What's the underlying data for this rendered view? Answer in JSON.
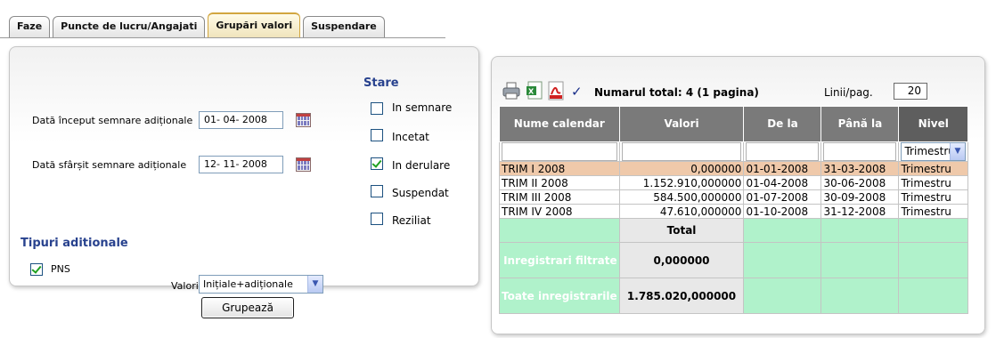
{
  "tabs": [
    {
      "label": "Faze",
      "active": false
    },
    {
      "label": "Puncte de lucru/Angajati",
      "active": false
    },
    {
      "label": "Grupări valori",
      "active": true
    },
    {
      "label": "Suspendare",
      "active": false
    }
  ],
  "form": {
    "start_date": {
      "label": "Dată început semnare adiționale",
      "value": "01- 04- 2008"
    },
    "end_date": {
      "label": "Dată sfârșit semnare adiționale",
      "value": "12- 11- 2008"
    },
    "valori": {
      "label": "Valori",
      "selected": "Inițiale+adiționale"
    }
  },
  "stare": {
    "title": "Stare",
    "options": [
      {
        "label": "In semnare",
        "checked": false
      },
      {
        "label": "Incetat",
        "checked": false
      },
      {
        "label": "In derulare",
        "checked": true
      },
      {
        "label": "Suspendat",
        "checked": false
      },
      {
        "label": "Reziliat",
        "checked": false
      }
    ]
  },
  "tipuri": {
    "title": "Tipuri aditionale",
    "options": [
      {
        "label": "PNS",
        "checked": true
      }
    ]
  },
  "group_button": "Grupează",
  "results": {
    "total_text": "Numarul total: 4 (1 pagina)",
    "lines_label": "Linii/pag.",
    "lines_value": "20",
    "columns": [
      "Nume calendar",
      "Valori",
      "De la",
      "Până la",
      "Nivel"
    ],
    "nivel_filter": "Trimestru",
    "rows": [
      {
        "nume": "TRIM I 2008",
        "valori": "0,000000",
        "de_la": "01-01-2008",
        "pana_la": "31-03-2008",
        "nivel": "Trimestru"
      },
      {
        "nume": "TRIM II 2008",
        "valori": "1.152.910,000000",
        "de_la": "01-04-2008",
        "pana_la": "30-06-2008",
        "nivel": "Trimestru"
      },
      {
        "nume": "TRIM III 2008",
        "valori": "584.500,000000",
        "de_la": "01-07-2008",
        "pana_la": "30-09-2008",
        "nivel": "Trimestru"
      },
      {
        "nume": "TRIM IV 2008",
        "valori": "47.610,000000",
        "de_la": "01-10-2008",
        "pana_la": "31-12-2008",
        "nivel": "Trimestru"
      }
    ],
    "summary": {
      "total_header": "Total",
      "filtered_label": "Inregistrari filtrate",
      "filtered_value": "0,000000",
      "all_label": "Toate inregistrarile",
      "all_value": "1.785.020,000000"
    }
  }
}
